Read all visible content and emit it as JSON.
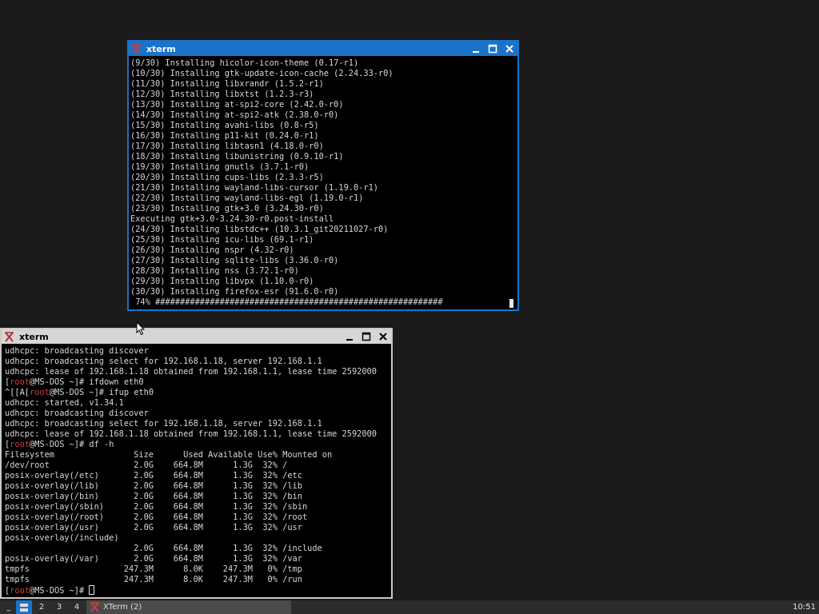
{
  "top_window": {
    "title": "xterm",
    "lines": [
      "(9/30) Installing hicolor-icon-theme (0.17-r1)",
      "(10/30) Installing gtk-update-icon-cache (2.24.33-r0)",
      "(11/30) Installing libxrandr (1.5.2-r1)",
      "(12/30) Installing libxtst (1.2.3-r3)",
      "(13/30) Installing at-spi2-core (2.42.0-r0)",
      "(14/30) Installing at-spi2-atk (2.38.0-r0)",
      "(15/30) Installing avahi-libs (0.8-r5)",
      "(16/30) Installing p11-kit (0.24.0-r1)",
      "(17/30) Installing libtasn1 (4.18.0-r0)",
      "(18/30) Installing libunistring (0.9.10-r1)",
      "(19/30) Installing gnutls (3.7.1-r0)",
      "(20/30) Installing cups-libs (2.3.3-r5)",
      "(21/30) Installing wayland-libs-cursor (1.19.0-r1)",
      "(22/30) Installing wayland-libs-egl (1.19.0-r1)",
      "(23/30) Installing gtk+3.0 (3.24.30-r0)",
      "Executing gtk+3.0-3.24.30-r0.post-install",
      "(24/30) Installing libstdc++ (10.3.1_git20211027-r0)",
      "(25/30) Installing icu-libs (69.1-r1)",
      "(26/30) Installing nspr (4.32-r0)",
      "(27/30) Installing sqlite-libs (3.36.0-r0)",
      "(28/30) Installing nss (3.72.1-r0)",
      "(29/30) Installing libvpx (1.10.0-r0)",
      "(30/30) Installing firefox-esr (91.6.0-r0)"
    ],
    "progress_text": " 74% ##########################################################"
  },
  "bottom_window": {
    "title": "xterm",
    "prompt_user": "root",
    "prompt_rest": "@MS-DOS ~]# ",
    "lines": [
      {
        "text": "udhcpc: broadcasting discover"
      },
      {
        "text": "udhcpc: broadcasting select for 192.168.1.18, server 192.168.1.1"
      },
      {
        "text": "udhcpc: lease of 192.168.1.18 obtained from 192.168.1.1, lease time 2592000"
      },
      {
        "prefix": "[",
        "cmd": "ifdown eth0"
      },
      {
        "prefix": "^[[A[",
        "cmd": "ifup eth0"
      },
      {
        "text": "udhcpc: started, v1.34.1"
      },
      {
        "text": "udhcpc: broadcasting discover"
      },
      {
        "text": "udhcpc: broadcasting select for 192.168.1.18, server 192.168.1.1"
      },
      {
        "text": "udhcpc: lease of 192.168.1.18 obtained from 192.168.1.1, lease time 2592000"
      },
      {
        "prefix": "[",
        "cmd": "df -h"
      },
      {
        "text": "Filesystem                Size      Used Available Use% Mounted on"
      },
      {
        "text": "/dev/root                 2.0G    664.8M      1.3G  32% /"
      },
      {
        "text": "posix-overlay(/etc)       2.0G    664.8M      1.3G  32% /etc"
      },
      {
        "text": "posix-overlay(/lib)       2.0G    664.8M      1.3G  32% /lib"
      },
      {
        "text": "posix-overlay(/bin)       2.0G    664.8M      1.3G  32% /bin"
      },
      {
        "text": "posix-overlay(/sbin)      2.0G    664.8M      1.3G  32% /sbin"
      },
      {
        "text": "posix-overlay(/root)      2.0G    664.8M      1.3G  32% /root"
      },
      {
        "text": "posix-overlay(/usr)       2.0G    664.8M      1.3G  32% /usr"
      },
      {
        "text": "posix-overlay(/include)"
      },
      {
        "text": "                          2.0G    664.8M      1.3G  32% /include"
      },
      {
        "text": "posix-overlay(/var)       2.0G    664.8M      1.3G  32% /var"
      },
      {
        "text": "tmpfs                   247.3M      8.0K    247.3M   0% /tmp"
      },
      {
        "text": "tmpfs                   247.3M      8.0K    247.3M   0% /run"
      },
      {
        "prefix": "[",
        "cmd": "",
        "cursor": true
      }
    ]
  },
  "taskbar": {
    "menu_label": "_",
    "workspaces": [
      "2",
      "3",
      "4"
    ],
    "task_label": "XTerm (2)",
    "clock": "10:51"
  },
  "colors": {
    "active_border": "#1a73c9",
    "prompt_user": "#d43a3a",
    "terminal_bg": "#000000",
    "terminal_fg": "#d7d7d7"
  }
}
